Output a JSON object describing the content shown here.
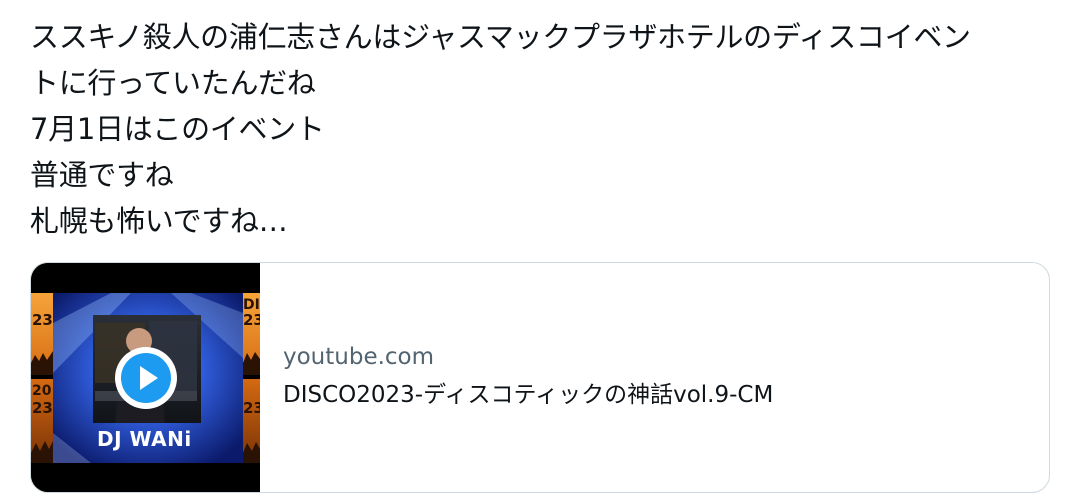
{
  "tweet": {
    "lines": [
      "ススキノ殺人の浦仁志さんはジャスマックプラザホテルのディスコイベン",
      "トに行っていたんだね",
      "7月1日はこのイベント",
      "普通ですね",
      "札幌も怖いですね…"
    ]
  },
  "card": {
    "domain": "youtube.com",
    "title": "DISCO2023-ディスコティックの神話vol.9-CM",
    "thumbnail": {
      "caption": "DJ WANi",
      "side_text_top": "DI",
      "side_text_top2": "20",
      "side_text_year": "23",
      "play_icon": "play-icon",
      "accent_color": "#1d9bf0"
    }
  }
}
